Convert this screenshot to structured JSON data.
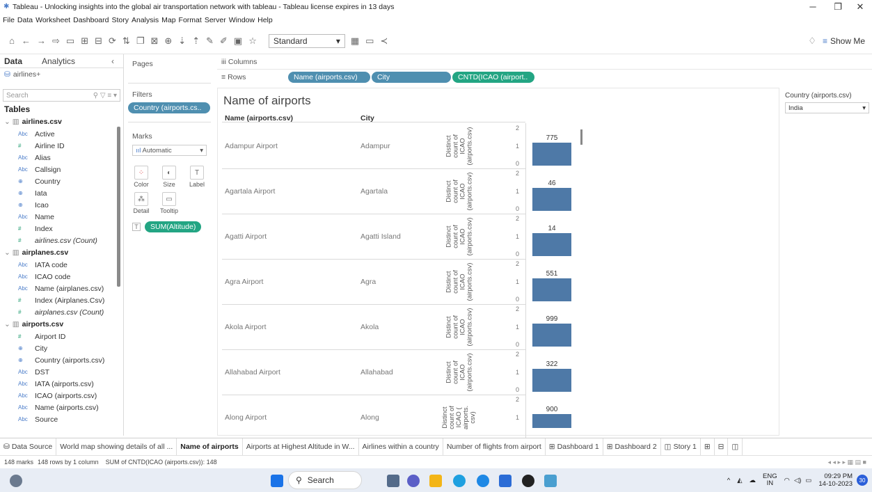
{
  "window": {
    "title": "Tableau - Unlocking insights into the global air transportation network with tableau - Tableau license expires in 13 days",
    "minimize": "─",
    "restore": "❐",
    "close": "✕"
  },
  "menu": [
    "File",
    "Data",
    "Worksheet",
    "Dashboard",
    "Story",
    "Analysis",
    "Map",
    "Format",
    "Server",
    "Window",
    "Help"
  ],
  "toolbar": {
    "fit_value": "Standard",
    "show_me_label": "Show Me"
  },
  "data_pane": {
    "tab_data": "Data",
    "tab_analytics": "Analytics",
    "datasource": "airlines+",
    "search_placeholder": "Search",
    "tables_heading": "Tables",
    "tables": [
      {
        "name": "airlines.csv",
        "fields": [
          {
            "type": "Abc",
            "name": "Active"
          },
          {
            "type": "#",
            "name": "Airline ID"
          },
          {
            "type": "Abc",
            "name": "Alias"
          },
          {
            "type": "Abc",
            "name": "Callsign"
          },
          {
            "type": "⊕",
            "name": "Country"
          },
          {
            "type": "⊕",
            "name": "Iata"
          },
          {
            "type": "⊕",
            "name": "Icao"
          },
          {
            "type": "Abc",
            "name": "Name"
          },
          {
            "type": "#",
            "name": "Index"
          },
          {
            "type": "#",
            "name": "airlines.csv (Count)"
          }
        ]
      },
      {
        "name": "airplanes.csv",
        "fields": [
          {
            "type": "Abc",
            "name": "IATA code"
          },
          {
            "type": "Abc",
            "name": "ICAO code"
          },
          {
            "type": "Abc",
            "name": "Name (airplanes.csv)"
          },
          {
            "type": "#",
            "name": "Index (Airplanes.Csv)"
          },
          {
            "type": "#",
            "name": "airplanes.csv (Count)"
          }
        ]
      },
      {
        "name": "airports.csv",
        "fields": [
          {
            "type": "#",
            "name": "Airport ID"
          },
          {
            "type": "⊕",
            "name": "City"
          },
          {
            "type": "⊕",
            "name": "Country (airports.csv)"
          },
          {
            "type": "Abc",
            "name": "DST"
          },
          {
            "type": "Abc",
            "name": "IATA (airports.csv)"
          },
          {
            "type": "Abc",
            "name": "ICAO (airports.csv)"
          },
          {
            "type": "Abc",
            "name": "Name (airports.csv)"
          },
          {
            "type": "Abc",
            "name": "Source"
          }
        ]
      }
    ]
  },
  "cards": {
    "pages": "Pages",
    "filters": "Filters",
    "filter_pill": "Country (airports.cs..",
    "marks": "Marks",
    "mark_type": "Automatic",
    "color": "Color",
    "size": "Size",
    "label": "Label",
    "detail": "Detail",
    "tooltip": "Tooltip",
    "marks_pill": "SUM(Altitude)"
  },
  "shelves": {
    "columns_label": "Columns",
    "rows_label": "Rows",
    "row_pills": [
      "Name (airports.csv)",
      "City",
      "CNTD(ICAO (airport.."
    ]
  },
  "view": {
    "title": "Name of airports",
    "header_name": "Name (airports.csv)",
    "header_city": "City",
    "axis_label": "Distinct count of ICAO (airports.csv)",
    "axis_label_last": "Distinct count of ICAO ( airports. csv)",
    "ticks": [
      "2",
      "1",
      "0"
    ],
    "rows": [
      {
        "name": "Adampur Airport",
        "city": "Adampur",
        "value": 775
      },
      {
        "name": "Agartala Airport",
        "city": "Agartala",
        "value": 46
      },
      {
        "name": "Agatti Airport",
        "city": "Agatti Island",
        "value": 14
      },
      {
        "name": "Agra Airport",
        "city": "Agra",
        "value": 551
      },
      {
        "name": "Akola Airport",
        "city": "Akola",
        "value": 999
      },
      {
        "name": "Allahabad Airport",
        "city": "Allahabad",
        "value": 322
      },
      {
        "name": "Along Airport",
        "city": "Along",
        "value": 900
      }
    ]
  },
  "country_filter": {
    "title": "Country (airports.csv)",
    "value": "India"
  },
  "sheet_tabs": [
    {
      "label": "Data Source",
      "active": false
    },
    {
      "label": "World map showing details of all ...",
      "active": false
    },
    {
      "label": "Name of airports",
      "active": true
    },
    {
      "label": "Airports at Highest Altitude in W...",
      "active": false
    },
    {
      "label": "Airlines within a country",
      "active": false
    },
    {
      "label": "Number of flights from airport",
      "active": false
    },
    {
      "label": "Dashboard 1",
      "active": false
    },
    {
      "label": "Dashboard 2",
      "active": false
    },
    {
      "label": "Story 1",
      "active": false
    }
  ],
  "status": {
    "marks": "148 marks",
    "rows": "148 rows by 1 column",
    "sum": "SUM of CNTD(ICAO (airports.csv)): 148"
  },
  "taskbar": {
    "search": "Search",
    "lang1": "ENG",
    "lang2": "IN",
    "time": "09:29 PM",
    "date": "14-10-2023",
    "notif": "30"
  }
}
